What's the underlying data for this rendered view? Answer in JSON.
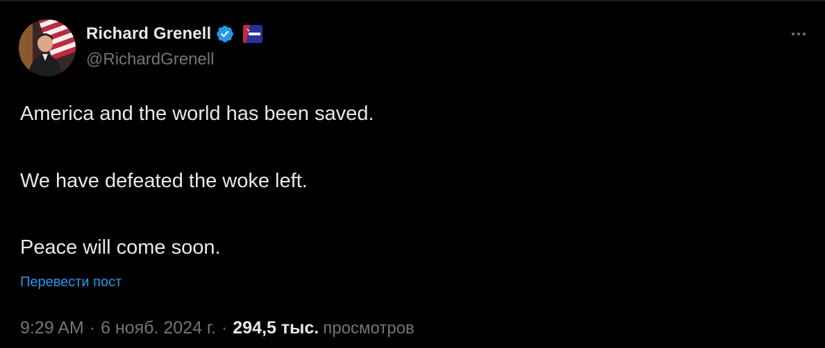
{
  "author": {
    "display_name": "Richard Grenell",
    "handle": "@RichardGrenell",
    "verified_icon": "verified-badge-icon",
    "affiliate_icon": "cpac-affiliate-badge-icon"
  },
  "post": {
    "lines": [
      "America and the world has been saved.",
      "We have defeated the woke left.",
      "Peace will come soon."
    ],
    "translate_label": "Перевести пост"
  },
  "meta": {
    "time": "9:29 AM",
    "date": "6 нояб. 2024 г.",
    "separator": "·",
    "views_count": "294,5 тыс.",
    "views_label": "просмотров"
  },
  "colors": {
    "background": "#000000",
    "text_primary": "#e7e9ea",
    "text_secondary": "#71767b",
    "link": "#1d9bf0",
    "verified": "#1d9bf0"
  }
}
